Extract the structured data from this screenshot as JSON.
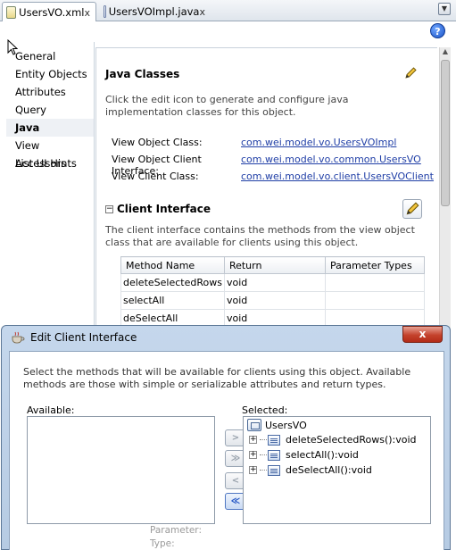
{
  "tabs": [
    {
      "label": "UsersVO.xml",
      "close": "x",
      "active": true
    },
    {
      "label": "UsersVOImpl.java",
      "close": "x",
      "active": false
    }
  ],
  "help_label": "?",
  "nav": {
    "items": [
      "General",
      "Entity Objects",
      "Attributes",
      "Query",
      "Java",
      "View Accessors",
      "List UI Hints"
    ],
    "selected": "Java"
  },
  "java_classes": {
    "title": "Java Classes",
    "description": "Click the edit icon to generate and configure java implementation classes for this object.",
    "rows": [
      {
        "label": "View Object Class:",
        "value": "com.wei.model.vo.UsersVOImpl"
      },
      {
        "label": "View Object Client Interface:",
        "value": "com.wei.model.vo.common.UsersVO"
      },
      {
        "label": "View Client Class:",
        "value": "com.wei.model.vo.client.UsersVOClient"
      }
    ]
  },
  "client_interface": {
    "collapse_symbol": "−",
    "title": "Client Interface",
    "description": "The client interface contains the methods from the view object class that are available for clients using this object.",
    "columns": [
      "Method Name",
      "Return",
      "Parameter Types"
    ],
    "rows": [
      [
        "deleteSelectedRows",
        "void",
        ""
      ],
      [
        "selectAll",
        "void",
        ""
      ],
      [
        "deSelectAll",
        "void",
        ""
      ]
    ]
  },
  "dialog": {
    "title": "Edit Client Interface",
    "close_label": "x",
    "description": "Select the methods that will be available for clients using this object.  Available methods are those with simple or serializable attributes and return types.",
    "available_label": "Available:",
    "selected_label": "Selected:",
    "buttons": [
      ">",
      "≫",
      "<",
      "≪"
    ],
    "selected_root": "UsersVO",
    "selected_methods": [
      "deleteSelectedRows():void",
      "selectAll():void",
      "deSelectAll():void"
    ],
    "parameter_label": "Parameter:",
    "type_label": "Type:"
  },
  "colors": {
    "link": "#1f3ea6",
    "dialog_frame": "#b6cbe3",
    "close_red": "#c4422c",
    "tab_border": "#9aa8b8"
  }
}
